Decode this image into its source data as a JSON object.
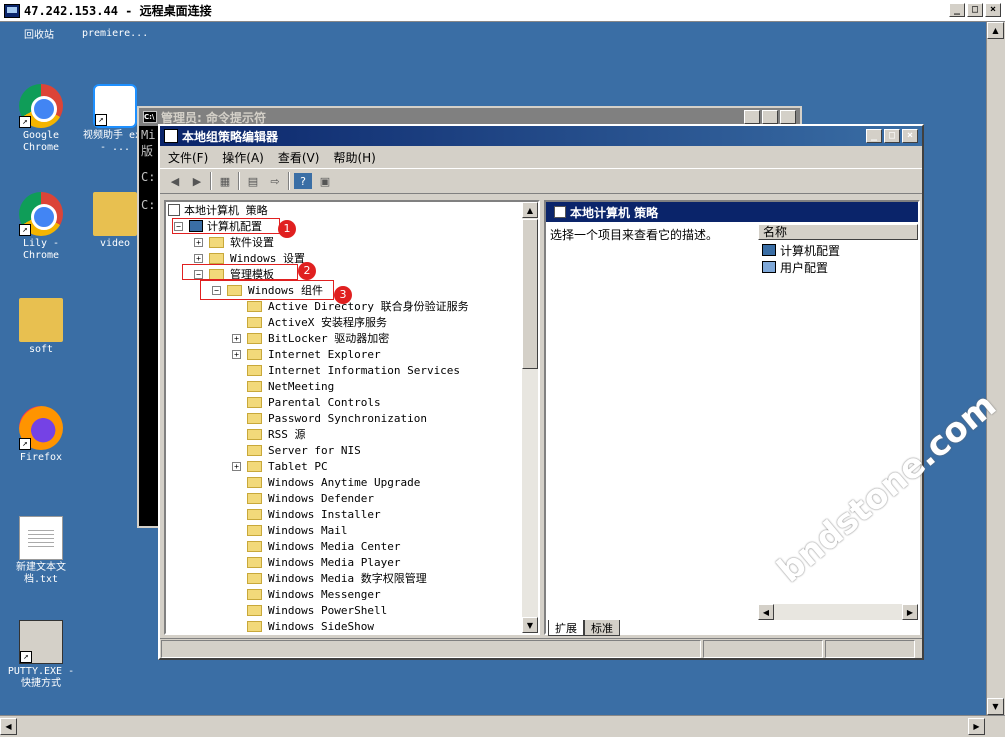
{
  "rdp": {
    "title": "47.242.153.44 - 远程桌面连接",
    "btns": [
      "_",
      "□",
      "×"
    ]
  },
  "desktop": {
    "top_labels": [
      "回收站",
      "premiere..."
    ],
    "icons": [
      {
        "label": "Google Chrome"
      },
      {
        "label": "视频助手 exe - ..."
      },
      {
        "label": "Lily - Chrome"
      },
      {
        "label": "video"
      },
      {
        "label": "soft"
      },
      {
        "label": "Firefox"
      },
      {
        "label": "新建文本文档.txt"
      },
      {
        "label": "PUTTY.EXE - 快捷方式"
      }
    ]
  },
  "cmd": {
    "title": "管理员: 命令提示符",
    "lines": [
      "Mi",
      "版",
      "",
      "C:",
      "",
      "C:"
    ]
  },
  "gpe": {
    "title": "本地组策略编辑器",
    "menus": [
      "文件(F)",
      "操作(A)",
      "查看(V)",
      "帮助(H)"
    ],
    "tree_root": "本地计算机 策略",
    "tree": [
      {
        "label": "计算机配置",
        "exp": "−"
      },
      {
        "label": "软件设置",
        "exp": "+"
      },
      {
        "label": "Windows 设置",
        "exp": "+"
      },
      {
        "label": "管理模板",
        "exp": "−"
      },
      {
        "label": "Windows 组件",
        "exp": "−"
      },
      {
        "label": "Active Directory 联合身份验证服务",
        "exp": ""
      },
      {
        "label": "ActiveX 安装程序服务",
        "exp": ""
      },
      {
        "label": "BitLocker 驱动器加密",
        "exp": "+"
      },
      {
        "label": "Internet Explorer",
        "exp": "+"
      },
      {
        "label": "Internet Information Services",
        "exp": ""
      },
      {
        "label": "NetMeeting",
        "exp": ""
      },
      {
        "label": "Parental Controls",
        "exp": ""
      },
      {
        "label": "Password Synchronization",
        "exp": ""
      },
      {
        "label": "RSS 源",
        "exp": ""
      },
      {
        "label": "Server for NIS",
        "exp": ""
      },
      {
        "label": "Tablet PC",
        "exp": "+"
      },
      {
        "label": "Windows Anytime Upgrade",
        "exp": ""
      },
      {
        "label": "Windows Defender",
        "exp": ""
      },
      {
        "label": "Windows Installer",
        "exp": ""
      },
      {
        "label": "Windows Mail",
        "exp": ""
      },
      {
        "label": "Windows Media Center",
        "exp": ""
      },
      {
        "label": "Windows Media Player",
        "exp": ""
      },
      {
        "label": "Windows Media 数字权限管理",
        "exp": ""
      },
      {
        "label": "Windows Messenger",
        "exp": ""
      },
      {
        "label": "Windows PowerShell",
        "exp": ""
      },
      {
        "label": "Windows SideShow",
        "exp": ""
      }
    ],
    "right": {
      "header": "本地计算机 策略",
      "desc": "选择一个项目来查看它的描述。",
      "col": "名称",
      "items": [
        "计算机配置",
        "用户配置"
      ],
      "tabs": [
        "扩展",
        "标准"
      ]
    }
  },
  "callouts": [
    "1",
    "2",
    "3"
  ],
  "watermark": "bndstone.com"
}
